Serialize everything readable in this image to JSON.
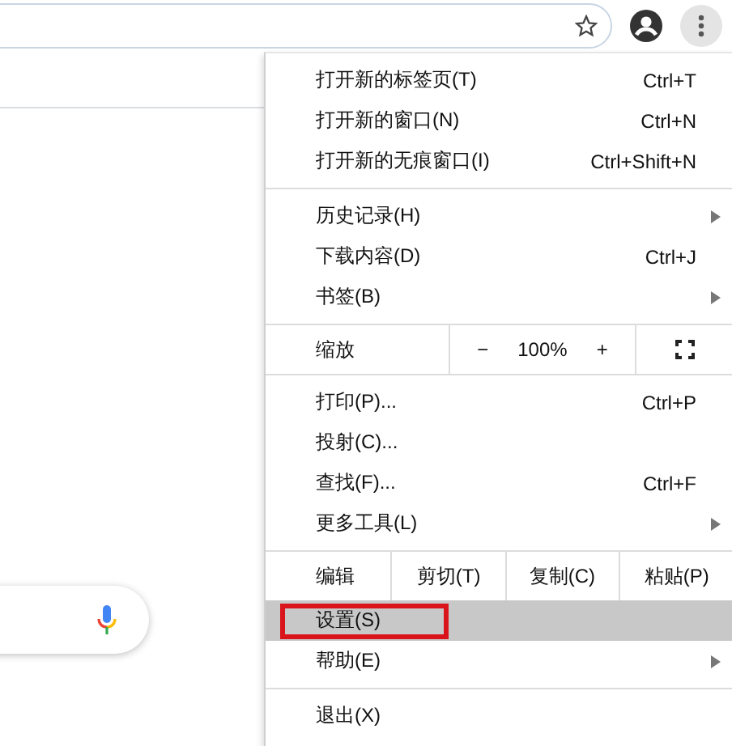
{
  "toolbar": {
    "bookmark_starred": false
  },
  "menu": {
    "groups": [
      {
        "kind": "items",
        "items": [
          {
            "label": "打开新的标签页(T)",
            "shortcut": "Ctrl+T",
            "has_submenu": false,
            "selected": false,
            "outlined": false
          },
          {
            "label": "打开新的窗口(N)",
            "shortcut": "Ctrl+N",
            "has_submenu": false,
            "selected": false,
            "outlined": false
          },
          {
            "label": "打开新的无痕窗口(I)",
            "shortcut": "Ctrl+Shift+N",
            "has_submenu": false,
            "selected": false,
            "outlined": false
          }
        ]
      },
      {
        "kind": "items",
        "items": [
          {
            "label": "历史记录(H)",
            "has_submenu": true,
            "selected": false,
            "outlined": false
          },
          {
            "label": "下载内容(D)",
            "shortcut": "Ctrl+J",
            "has_submenu": false,
            "selected": false,
            "outlined": false
          },
          {
            "label": "书签(B)",
            "has_submenu": true,
            "selected": false,
            "outlined": false
          }
        ]
      },
      {
        "kind": "zoom",
        "label": "缩放",
        "minus": "−",
        "value": "100%",
        "plus": "+"
      },
      {
        "kind": "items",
        "items": [
          {
            "label": "打印(P)...",
            "shortcut": "Ctrl+P",
            "has_submenu": false,
            "selected": false,
            "outlined": false
          },
          {
            "label": "投射(C)...",
            "has_submenu": false,
            "selected": false,
            "outlined": false
          },
          {
            "label": "查找(F)...",
            "shortcut": "Ctrl+F",
            "has_submenu": false,
            "selected": false,
            "outlined": false
          },
          {
            "label": "更多工具(L)",
            "has_submenu": true,
            "selected": false,
            "outlined": false
          }
        ]
      },
      {
        "kind": "edit",
        "label": "编辑",
        "buttons": [
          "剪切(T)",
          "复制(C)",
          "粘贴(P)"
        ]
      },
      {
        "kind": "items",
        "items": [
          {
            "label": "设置(S)",
            "has_submenu": false,
            "selected": true,
            "outlined": true
          },
          {
            "label": "帮助(E)",
            "has_submenu": true,
            "selected": false,
            "outlined": false
          }
        ]
      },
      {
        "kind": "items",
        "items": [
          {
            "label": "退出(X)",
            "has_submenu": false,
            "selected": false,
            "outlined": false
          }
        ]
      }
    ]
  }
}
